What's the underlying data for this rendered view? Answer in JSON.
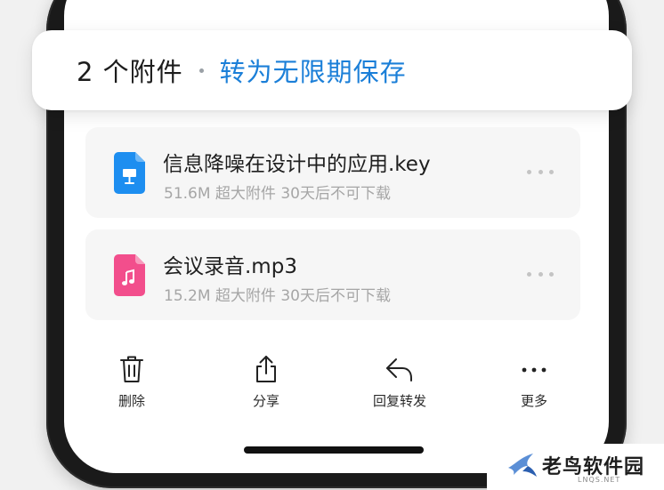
{
  "banner": {
    "count": "2 个附件",
    "action": "转为无限期保存",
    "accent_color": "#1b7fd8"
  },
  "attachments": [
    {
      "title": "信息降噪在设计中的应用.key",
      "meta": "51.6M 超大附件 30天后不可下载",
      "icon": "keynote-file-icon",
      "icon_color": "#1d8ef0"
    },
    {
      "title": "会议录音.mp3",
      "meta": "15.2M 超大附件 30天后不可下载",
      "icon": "audio-file-icon",
      "icon_color": "#f24e8c"
    }
  ],
  "toolbar": {
    "delete_label": "删除",
    "share_label": "分享",
    "reply_forward_label": "回复转发",
    "more_label": "更多"
  },
  "watermark": {
    "text": "老鸟软件园",
    "sub": "LNQS.NET"
  }
}
